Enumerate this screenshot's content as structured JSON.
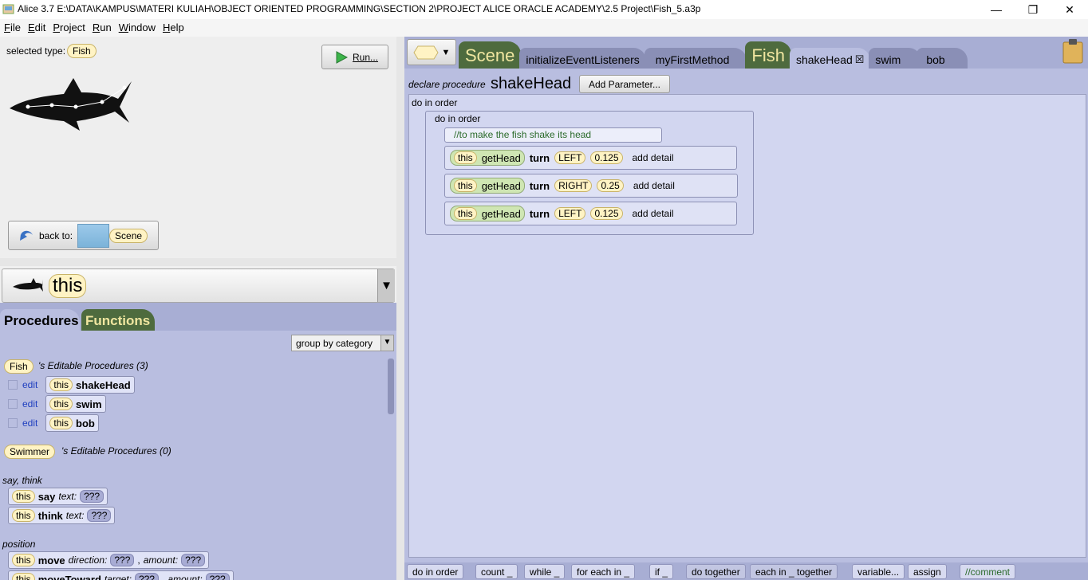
{
  "window": {
    "title": "Alice 3.7 E:\\DATA\\KAMPUS\\MATERI KULIAH\\OBJECT ORIENTED PROGRAMMING\\SECTION 2\\PROJECT ALICE ORACLE ACADEMY\\2.5 Project\\Fish_5.a3p",
    "minimize": "—",
    "restore": "❐",
    "close": "✕"
  },
  "menu": [
    "File",
    "Edit",
    "Project",
    "Run",
    "Window",
    "Help"
  ],
  "left": {
    "selected_type_label": "selected type:",
    "selected_type": "Fish",
    "run_label": "Run...",
    "back_label": "back to:",
    "back_target": "Scene",
    "selector_value": "this",
    "dropdown_arrow": "▼"
  },
  "tabs": {
    "procedures": "Procedures",
    "functions": "Functions"
  },
  "group": {
    "value": "group by category",
    "arrow": "▼"
  },
  "fish_procs": {
    "type": "Fish",
    "heading": "'s Editable Procedures (3)",
    "items": [
      {
        "edit": "edit",
        "this": "this",
        "name": "shakeHead"
      },
      {
        "edit": "edit",
        "this": "this",
        "name": "swim"
      },
      {
        "edit": "edit",
        "this": "this",
        "name": "bob"
      }
    ]
  },
  "swimmer_procs": {
    "type": "Swimmer",
    "heading": "'s Editable Procedures (0)"
  },
  "cat_say": "say, think",
  "say": {
    "this": "this",
    "name": "say",
    "arg": "text:",
    "val": "???"
  },
  "think": {
    "this": "this",
    "name": "think",
    "arg": "text:",
    "val": "???"
  },
  "cat_position": "position",
  "move": {
    "this": "this",
    "name": "move",
    "arg1": "direction:",
    "val1": "???",
    "sep": ",",
    "arg2": "amount:",
    "val2": "???"
  },
  "moveToward": {
    "this": "this",
    "name": "moveToward",
    "arg1": "target:",
    "val1": "???",
    "sep": ",",
    "arg2": "amount:",
    "val2": "???"
  },
  "editor_tabs": [
    {
      "label": "Scene"
    },
    {
      "label": "initializeEventListeners"
    },
    {
      "label": "myFirstMethod"
    },
    {
      "label": "Fish"
    },
    {
      "label": "shakeHead",
      "close": "☒"
    },
    {
      "label": "swim"
    },
    {
      "label": "bob"
    }
  ],
  "declare": {
    "label": "declare procedure",
    "name": "shakeHead",
    "add_param": "Add Parameter..."
  },
  "code": {
    "outer": "do in order",
    "inner": "do in order",
    "comment": "//to make the fish shake its head",
    "statements": [
      {
        "this": "this",
        "getter": "getHead",
        "verb": "turn",
        "dir": "LEFT",
        "amount": "0.125",
        "detail": "add detail"
      },
      {
        "this": "this",
        "getter": "getHead",
        "verb": "turn",
        "dir": "RIGHT",
        "amount": "0.25",
        "detail": "add detail"
      },
      {
        "this": "this",
        "getter": "getHead",
        "verb": "turn",
        "dir": "LEFT",
        "amount": "0.125",
        "detail": "add detail"
      }
    ]
  },
  "bottom": [
    "do in order",
    "count _",
    "while _",
    "for each in _",
    "if _",
    "do together",
    "each in _ together",
    "variable...",
    "assign",
    "//comment"
  ]
}
